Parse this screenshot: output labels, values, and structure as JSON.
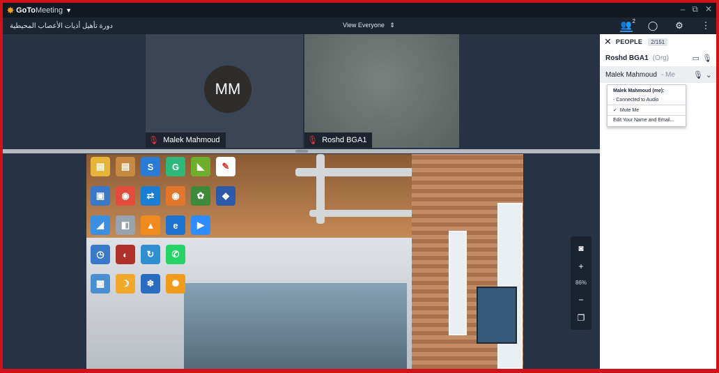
{
  "titlebar": {
    "brand_bold": "GoTo",
    "brand_light": "Meeting",
    "minimize": "–",
    "restore": "⧉",
    "close": "✕"
  },
  "toolbar": {
    "meeting_title": "دورة تأهيل أذيات الأعصاب المحيطية",
    "view_selector": "View Everyone",
    "people_count": "2"
  },
  "participants": [
    {
      "initials": "MM",
      "name": "Malek Mahmoud"
    },
    {
      "initials": "",
      "name": "Roshd BGA1"
    }
  ],
  "zoom": {
    "level": "86%"
  },
  "people_panel": {
    "title": "PEOPLE",
    "count": "2/151",
    "rows": [
      {
        "name": "Roshd BGA1",
        "role": "(Org)"
      },
      {
        "name": "Malek Mahmoud",
        "role": "- Me"
      }
    ]
  },
  "context_menu": {
    "header": "Malek Mahmoud (me):",
    "items": [
      "- Connected to Audio",
      "Mute Me",
      "Edit Your Name and Email..."
    ]
  },
  "colors": {
    "accent": "#d0121b",
    "brand_star": "#f7a21b",
    "mic_muted": "#e23a3a"
  }
}
